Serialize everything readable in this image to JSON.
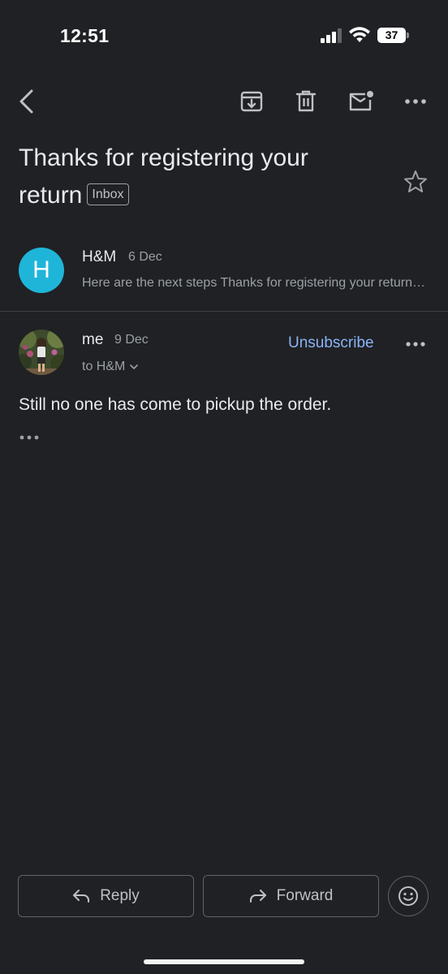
{
  "status_bar": {
    "time": "12:51",
    "battery_level": "37",
    "icons": [
      "cellular-signal-icon",
      "wifi-icon",
      "battery-icon"
    ]
  },
  "toolbar": {
    "icons": [
      "back-arrow-icon",
      "archive-icon",
      "trash-icon",
      "mark-unread-icon",
      "more-horizontal-icon"
    ]
  },
  "thread": {
    "subject": "Thanks for registering your return",
    "label": "Inbox",
    "starred": false
  },
  "messages": [
    {
      "avatar_letter": "H",
      "avatar_color": "#1fb5d9",
      "sender": "H&M",
      "date": "6 Dec",
      "snippet": "Here are the next steps Thanks for registering your return. Here are the next steps"
    },
    {
      "sender": "me",
      "date": "9 Dec",
      "recipient_line": "to H&M",
      "unsubscribe_label": "Unsubscribe",
      "body": "Still no one has come to pickup the order."
    }
  ],
  "actions": {
    "reply_label": "Reply",
    "forward_label": "Forward",
    "emoji_icon": "smiley-face-icon"
  },
  "colors": {
    "background": "#202124",
    "primary_text": "#e8eaed",
    "secondary_text": "#9aa0a6",
    "link": "#8ab4f8",
    "outline": "#5f6368"
  }
}
